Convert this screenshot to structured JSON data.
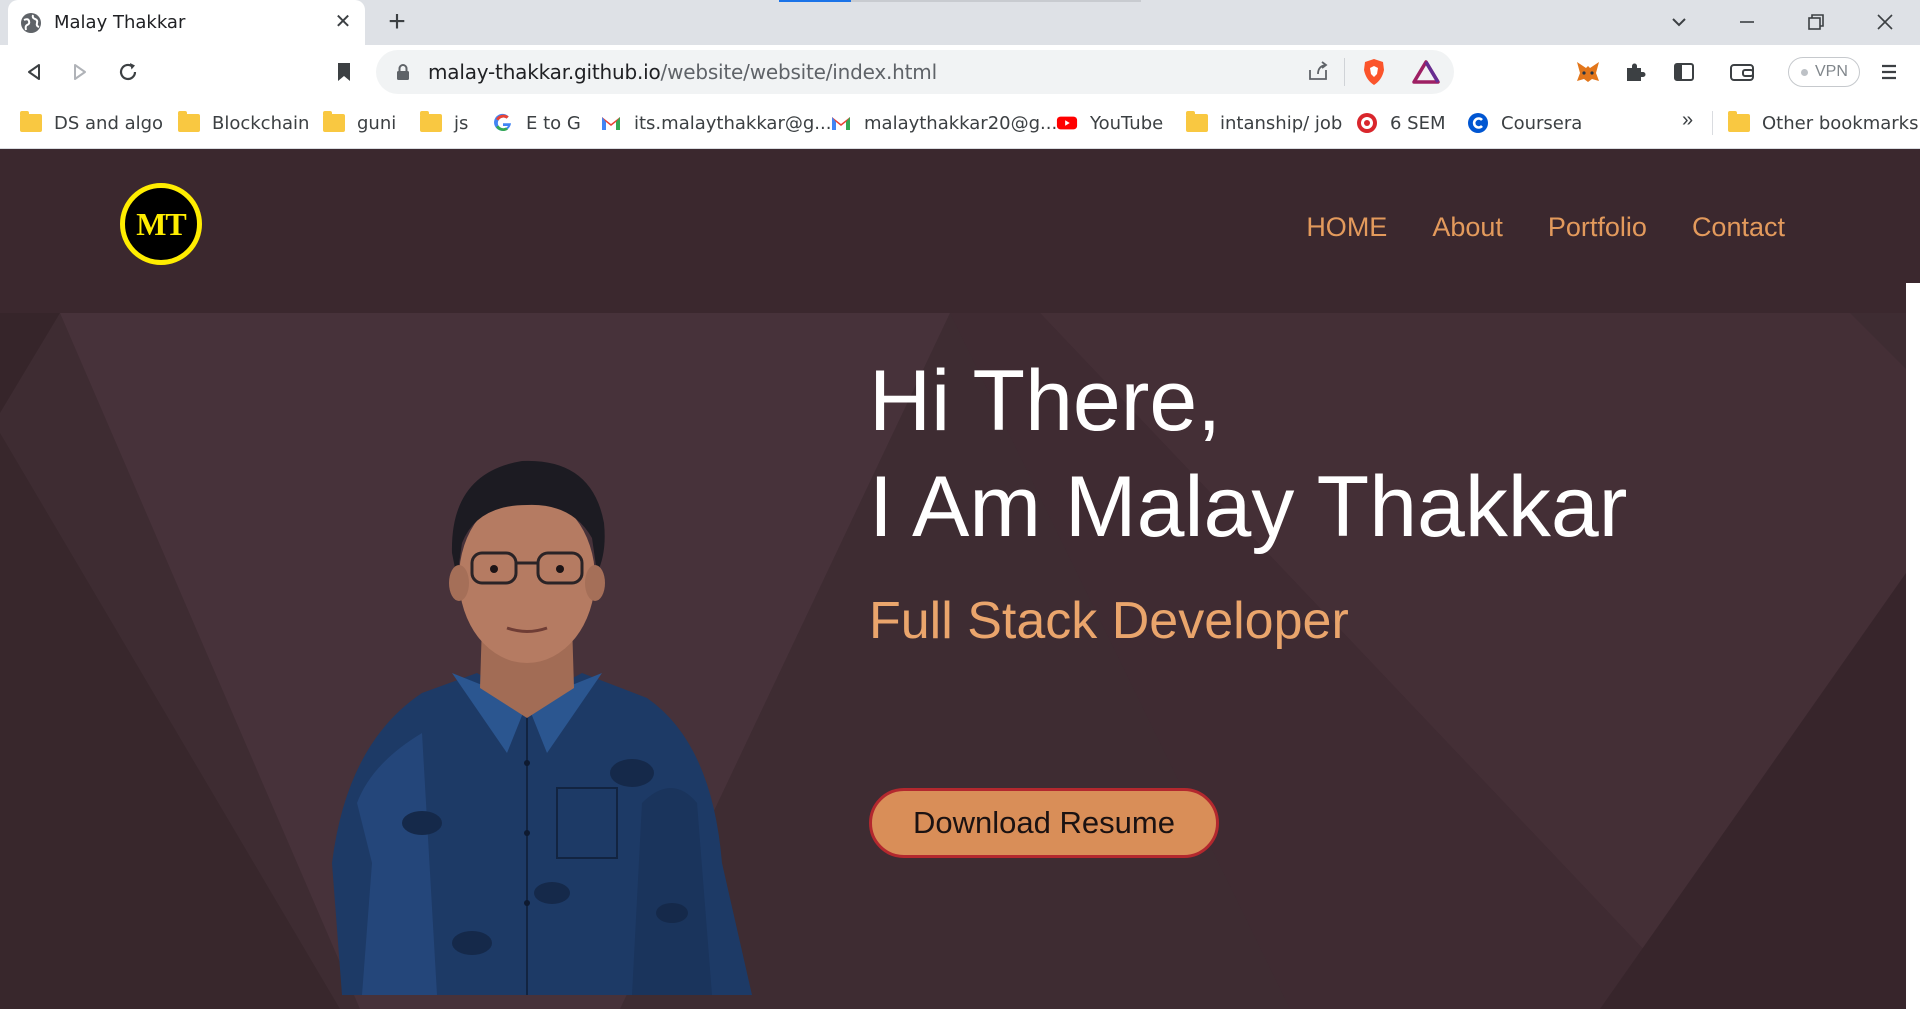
{
  "browser": {
    "tab": {
      "title": "Malay Thakkar",
      "close": "✕"
    },
    "new_tab": "+",
    "url": {
      "host": "malay-thakkar.github.io",
      "path": "/website/website/index.html"
    },
    "vpn_label": "VPN",
    "bookmarks": [
      {
        "label": "DS and algo",
        "icon": "folder-icon"
      },
      {
        "label": "Blockchain",
        "icon": "folder-icon"
      },
      {
        "label": "guni",
        "icon": "folder-icon"
      },
      {
        "label": "js",
        "icon": "folder-icon"
      },
      {
        "label": "E to G",
        "icon": "google-icon"
      },
      {
        "label": "its.malaythakkar@g...",
        "icon": "gmail-icon"
      },
      {
        "label": "malaythakkar20@g...",
        "icon": "gmail-icon"
      },
      {
        "label": "YouTube",
        "icon": "youtube-icon"
      },
      {
        "label": "intanship/ job",
        "icon": "folder-icon"
      },
      {
        "label": "6 SEM",
        "icon": "university-icon"
      },
      {
        "label": "Coursera",
        "icon": "coursera-icon"
      }
    ],
    "bookmarks_overflow": "»",
    "other_bookmarks": "Other bookmarks"
  },
  "site": {
    "logo_text": "MT",
    "nav": [
      "HOME",
      "About",
      "Portfolio",
      "Contact"
    ],
    "hero": {
      "line1": "Hi There,",
      "line2": "I Am Malay Thakkar",
      "role": "Full Stack Developer",
      "cta": "Download Resume"
    }
  },
  "colors": {
    "header_bg": "#3b282e",
    "hero_bg": "#3e2c32",
    "accent": "#e39a5c",
    "logo_ring": "#ffed00",
    "cta_bg": "#d98e58",
    "cta_border": "#b3282e"
  }
}
